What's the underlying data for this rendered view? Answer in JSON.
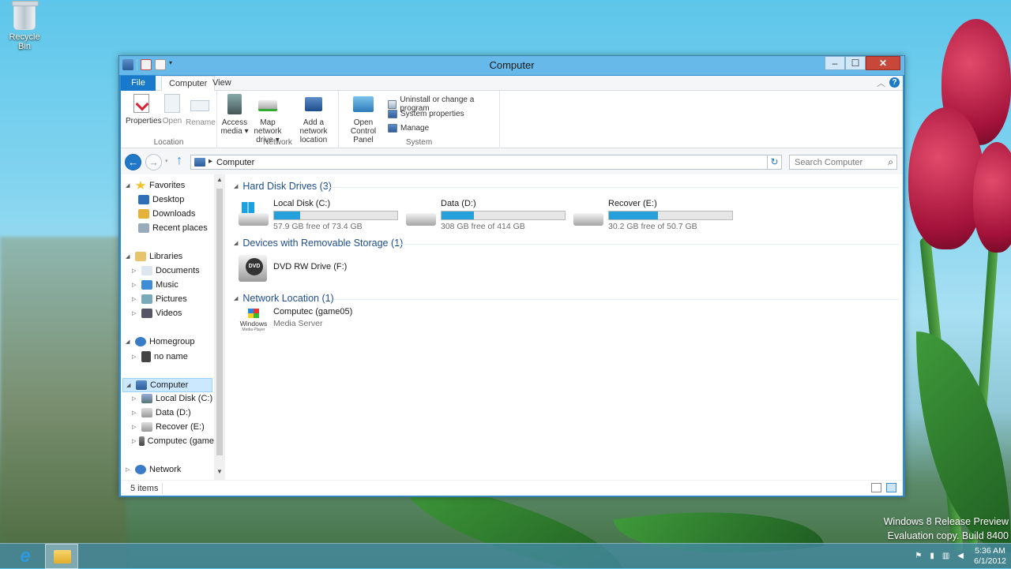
{
  "desktop": {
    "recycle_bin_label": "Recycle Bin",
    "watermark_line1": "Windows 8 Release Preview",
    "watermark_line2": "Evaluation copy. Build 8400"
  },
  "window": {
    "title": "Computer",
    "minimize": "–",
    "maximize": "☐",
    "close": "✕"
  },
  "ribbon": {
    "tabs": {
      "file": "File",
      "computer": "Computer",
      "view": "View"
    },
    "location": {
      "label": "Location",
      "properties": "Properties",
      "open": "Open",
      "rename": "Rename"
    },
    "network": {
      "label": "Network",
      "access_media_1": "Access",
      "access_media_2": "media ▾",
      "map_drive_1": "Map network",
      "map_drive_2": "drive ▾",
      "add_location_1": "Add a network",
      "add_location_2": "location"
    },
    "system": {
      "label": "System",
      "control_panel_1": "Open Control",
      "control_panel_2": "Panel",
      "uninstall": "Uninstall or change a program",
      "system_properties": "System properties",
      "manage": "Manage"
    }
  },
  "navbar": {
    "address_path": "Computer",
    "search_placeholder": "Search Computer"
  },
  "nav_pane": {
    "favorites": "Favorites",
    "desktop": "Desktop",
    "downloads": "Downloads",
    "recent_places": "Recent places",
    "libraries": "Libraries",
    "documents": "Documents",
    "music": "Music",
    "pictures": "Pictures",
    "videos": "Videos",
    "homegroup": "Homegroup",
    "no_name": "no name",
    "computer": "Computer",
    "local_disk": "Local Disk (C:)",
    "data": "Data (D:)",
    "recover": "Recover (E:)",
    "computec": "Computec (game",
    "network": "Network"
  },
  "main": {
    "hdd_header": "Hard Disk Drives (3)",
    "removable_header": "Devices with Removable Storage (1)",
    "network_header": "Network Location (1)",
    "drives": [
      {
        "name": "Local Disk (C:)",
        "free": "57.9 GB free of 73.4 GB",
        "used_fraction": 0.21
      },
      {
        "name": "Data (D:)",
        "free": "308 GB free of 414 GB",
        "used_fraction": 0.26
      },
      {
        "name": "Recover (E:)",
        "free": "30.2 GB free of 50.7 GB",
        "used_fraction": 0.4
      }
    ],
    "dvd": {
      "name": "DVD RW Drive (F:)",
      "icon_text": "DVD"
    },
    "network_item": {
      "name": "Computec (game05)",
      "subtitle": "Media Server",
      "icon_text_1": "Windows",
      "icon_text_2": "Media Player"
    }
  },
  "status": {
    "items_count": "5 items"
  },
  "taskbar": {
    "time": "5:36 AM",
    "date": "6/1/2012"
  },
  "colors": {
    "accent": "#1979ca",
    "drive_bar": "#26a0da",
    "section_header": "#1e4e8c"
  }
}
